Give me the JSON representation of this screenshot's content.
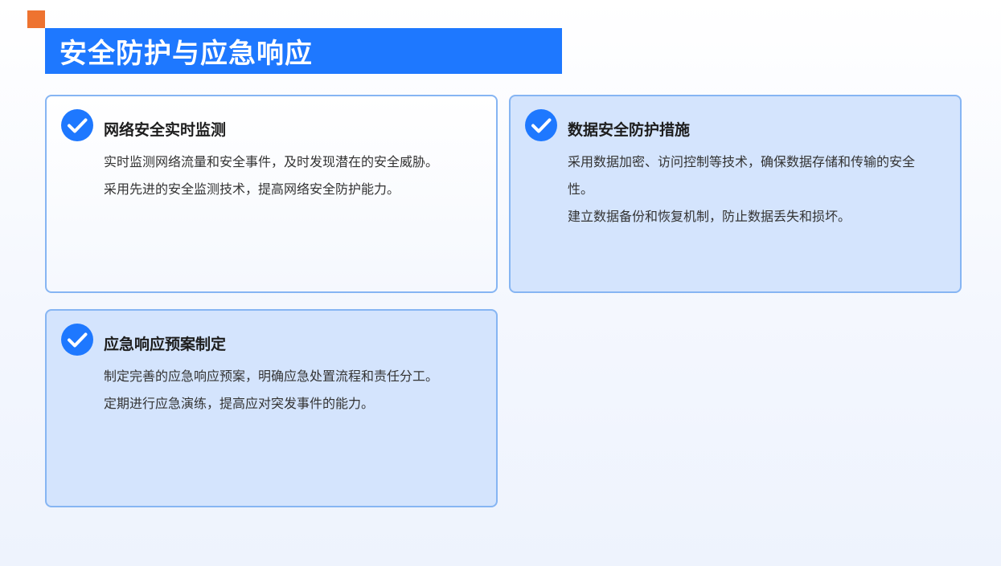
{
  "colors": {
    "accent_orange": "#ee7330",
    "primary_blue": "#1e78ff",
    "card_border": "#86b5f3",
    "card_tint": "#d4e4fd"
  },
  "header": {
    "title": "安全防护与应急响应"
  },
  "cards": [
    {
      "icon": "check-circle-icon",
      "title": "网络安全实时监测",
      "lines": [
        "实时监测网络流量和安全事件，及时发现潜在的安全威胁。",
        "采用先进的安全监测技术，提高网络安全防护能力。"
      ]
    },
    {
      "icon": "check-circle-icon",
      "title": "数据安全防护措施",
      "lines": [
        "采用数据加密、访问控制等技术，确保数据存储和传输的安全性。",
        "建立数据备份和恢复机制，防止数据丢失和损坏。"
      ]
    },
    {
      "icon": "check-circle-icon",
      "title": "应急响应预案制定",
      "lines": [
        "制定完善的应急响应预案，明确应急处置流程和责任分工。",
        "定期进行应急演练，提高应对突发事件的能力。"
      ]
    }
  ]
}
